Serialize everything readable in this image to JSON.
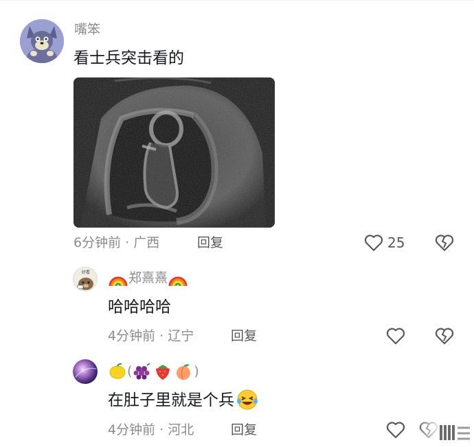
{
  "comments": [
    {
      "username": "嘴笨",
      "text": "看士兵突击看的",
      "time_location": "6分钟前 · 广西",
      "reply_label": "回复",
      "like_count": "25"
    }
  ],
  "replies": [
    {
      "username": "郑熹熹",
      "text": "哈哈哈哈",
      "time_location": "4分钟前 · 辽宁",
      "reply_label": "回复"
    },
    {
      "username": "(",
      "username_close": ")",
      "text": "在肚子里就是个兵",
      "time_location": "4分钟前 · 河北",
      "reply_label": "回复"
    }
  ],
  "icons": {
    "like": "heart-outline-icon",
    "dislike": "broken-heart-icon",
    "avatar_badge": "好看"
  },
  "colors": {
    "secondary_text": "#8a8b91",
    "primary_text": "#161823",
    "icon": "#57585e"
  }
}
